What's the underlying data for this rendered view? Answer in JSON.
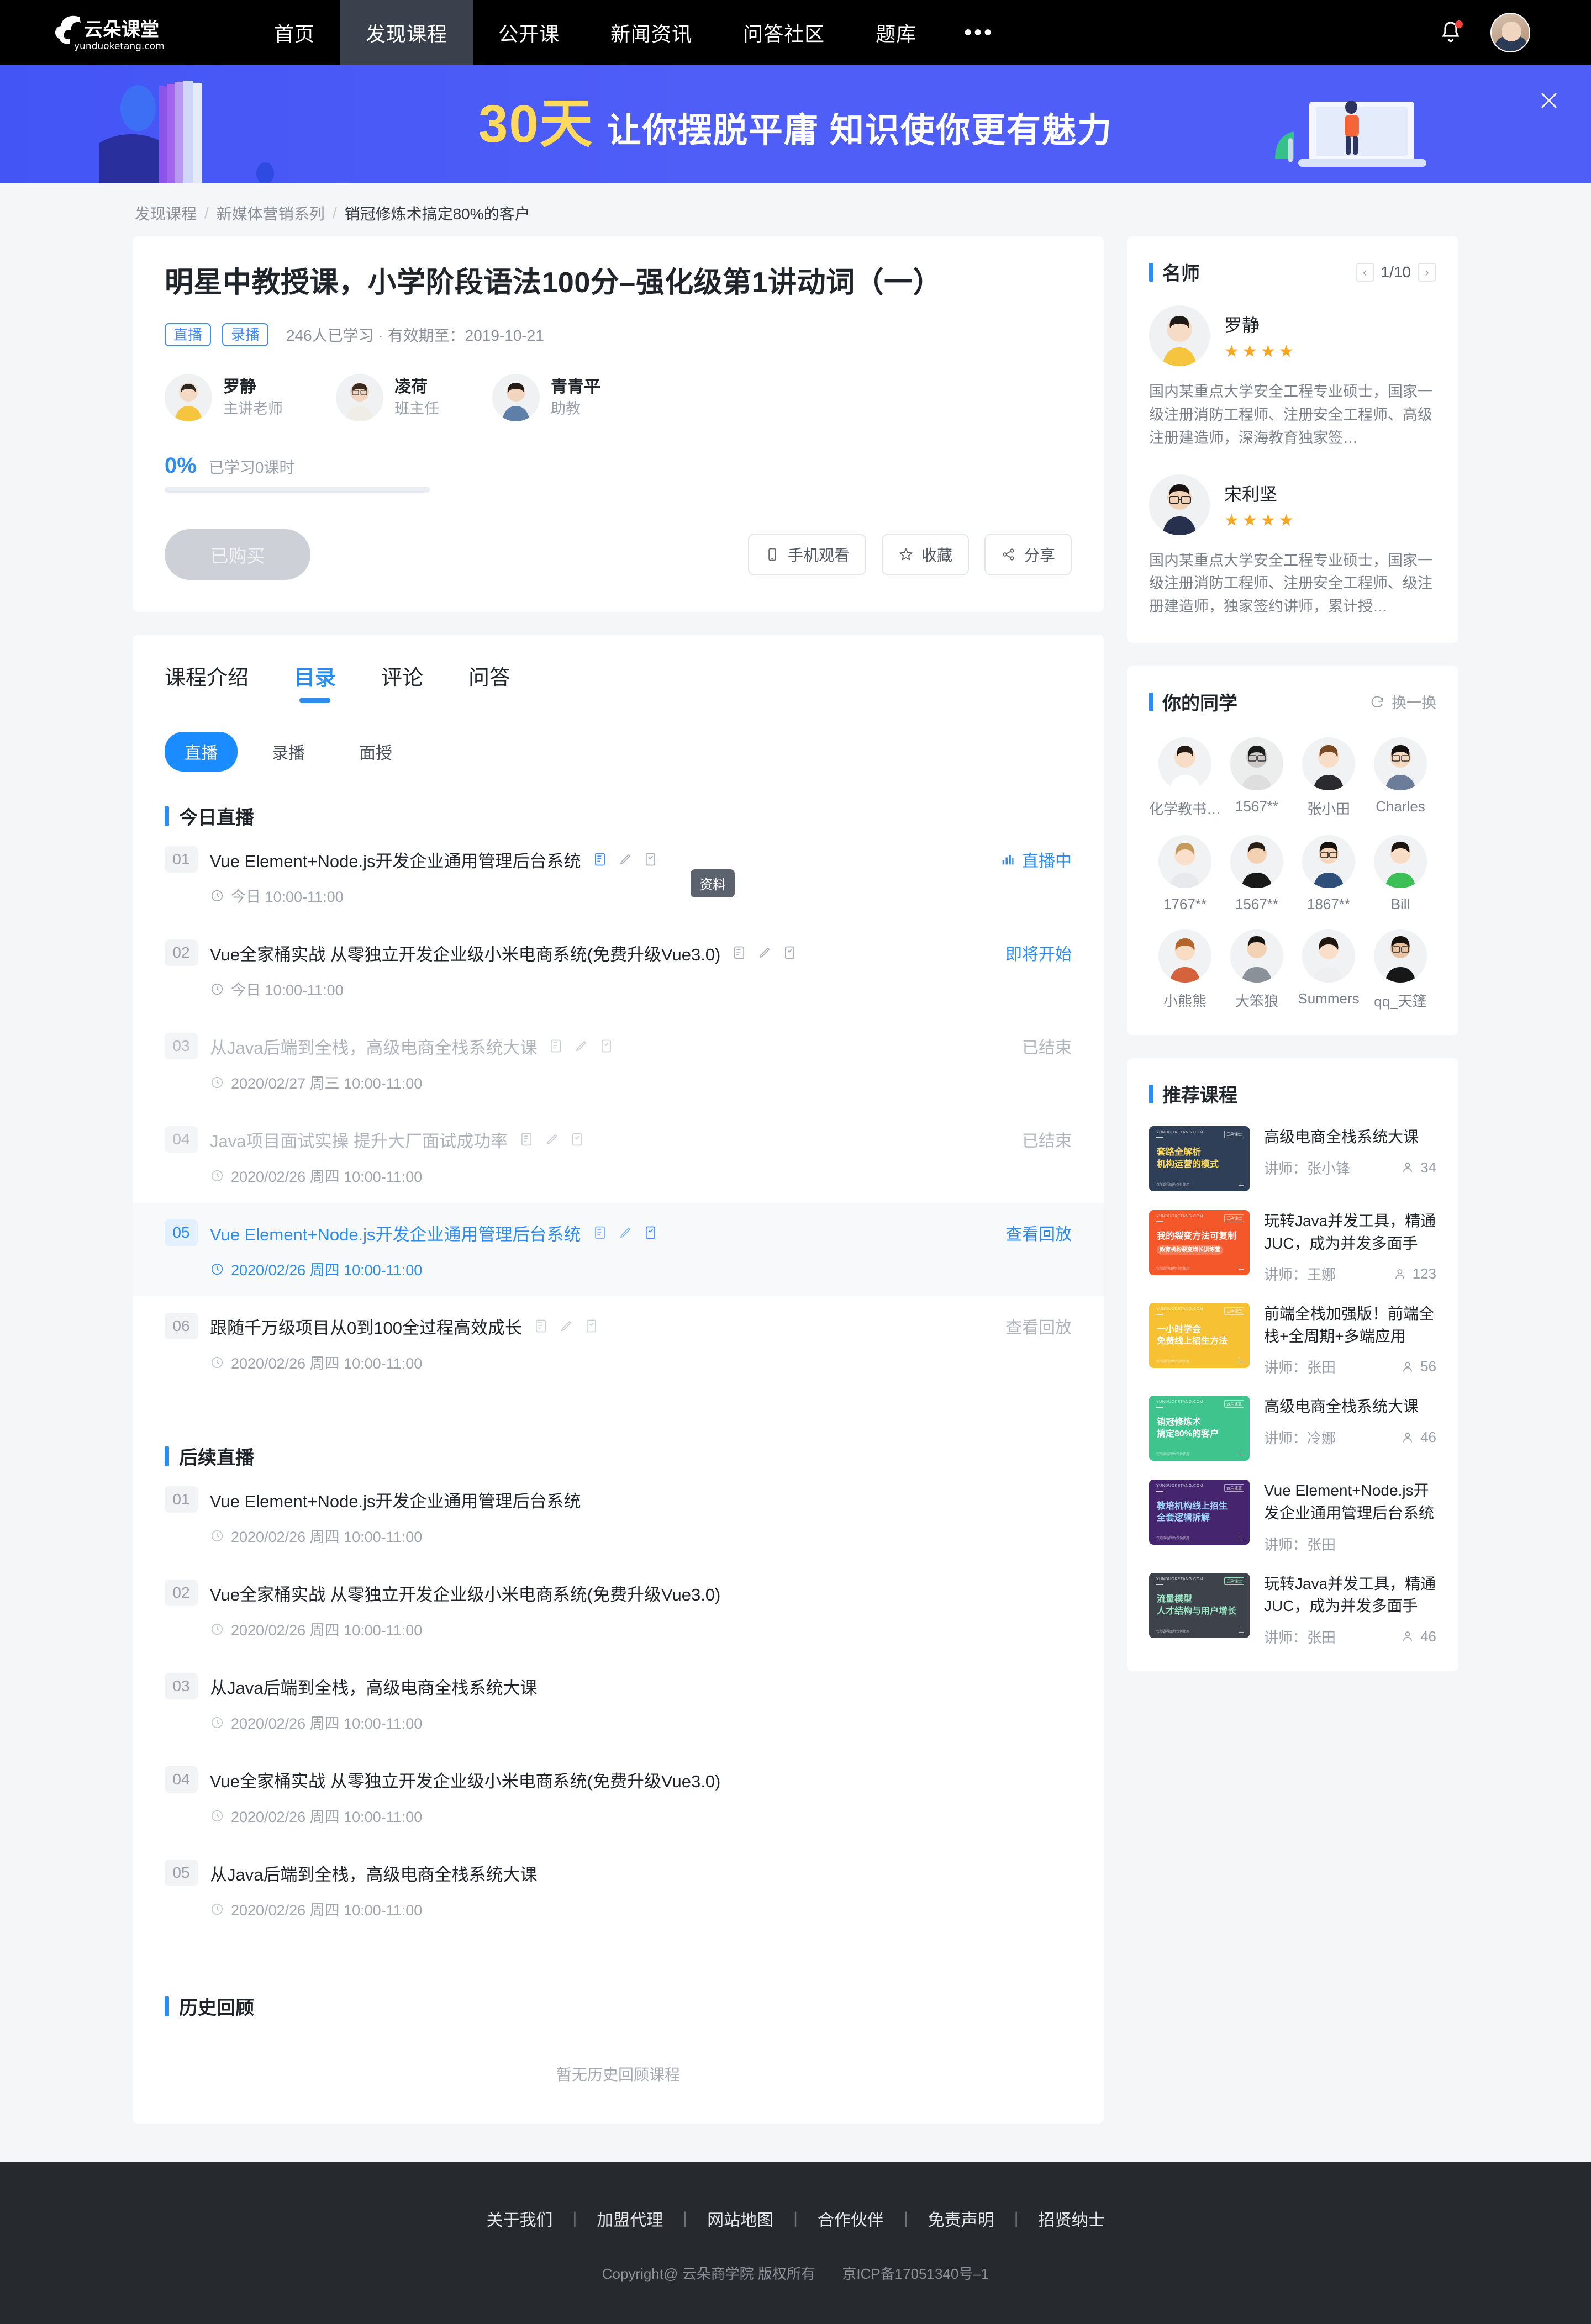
{
  "brand": {
    "name": "云朵课堂",
    "domain": "yunduoketang.com"
  },
  "nav": {
    "items": [
      {
        "label": "首页",
        "active": false
      },
      {
        "label": "发现课程",
        "active": true
      },
      {
        "label": "公开课",
        "active": false
      },
      {
        "label": "新闻资讯",
        "active": false
      },
      {
        "label": "问答社区",
        "active": false
      },
      {
        "label": "题库",
        "active": false
      }
    ],
    "more": "•••",
    "bell_icon": "bell-icon",
    "avatar_icon": "user-avatar"
  },
  "banner": {
    "big": "30天",
    "sub": "让你摆脱平庸  知识使你更有魅力",
    "close_icon": "close-icon"
  },
  "breadcrumb": {
    "items": [
      "发现课程",
      "新媒体营销系列"
    ],
    "current": "销冠修炼术搞定80%的客户",
    "separator": "/"
  },
  "course": {
    "title": "明星中教授课，小学阶段语法100分–强化级第1讲动词（一）",
    "tags": [
      "直播",
      "录播"
    ],
    "meta": "246人已学习 · 有效期至：2019-10-21",
    "teachers": [
      {
        "name": "罗静",
        "role": "主讲老师"
      },
      {
        "name": "凌荷",
        "role": "班主任"
      },
      {
        "name": "青青平",
        "role": "助教"
      }
    ],
    "progress": {
      "percent": "0%",
      "label": "已学习0课时",
      "value": 0
    },
    "buy_label": "已购买",
    "actions": [
      {
        "label": "手机观看",
        "icon": "phone-icon"
      },
      {
        "label": "收藏",
        "icon": "star-icon"
      },
      {
        "label": "分享",
        "icon": "share-icon"
      }
    ]
  },
  "tabs": [
    {
      "label": "课程介绍",
      "active": false
    },
    {
      "label": "目录",
      "active": true
    },
    {
      "label": "评论",
      "active": false
    },
    {
      "label": "问答",
      "active": false
    }
  ],
  "subtabs": [
    {
      "label": "直播",
      "active": true
    },
    {
      "label": "录播",
      "active": false
    },
    {
      "label": "面授",
      "active": false
    }
  ],
  "tooltip": "资料",
  "sections": [
    {
      "title": "今日直播",
      "lessons": [
        {
          "num": "01",
          "title": "Vue Element+Node.js开发企业通用管理后台系统",
          "time": "今日 10:00-11:00",
          "status": "直播中",
          "status_type": "live",
          "icons": true,
          "state": "normal"
        },
        {
          "num": "02",
          "title": "Vue全家桶实战 从零独立开发企业级小米电商系统(免费升级Vue3.0)",
          "time": "今日 10:00-11:00",
          "status": "即将开始",
          "status_type": "soon",
          "icons": true,
          "state": "normal"
        },
        {
          "num": "03",
          "title": "从Java后端到全栈，高级电商全栈系统大课",
          "time": "2020/02/27 周三 10:00-11:00",
          "status": "已结束",
          "status_type": "end",
          "icons": true,
          "state": "done"
        },
        {
          "num": "04",
          "title": "Java项目面试实操 提升大厂面试成功率",
          "time": "2020/02/26 周四 10:00-11:00",
          "status": "已结束",
          "status_type": "end",
          "icons": true,
          "state": "done"
        },
        {
          "num": "05",
          "title": "Vue Element+Node.js开发企业通用管理后台系统",
          "time": "2020/02/26 周四 10:00-11:00",
          "status": "查看回放",
          "status_type": "replay",
          "icons": true,
          "state": "highlight"
        },
        {
          "num": "06",
          "title": "跟随千万级项目从0到100全过程高效成长",
          "time": "2020/02/26 周四 10:00-11:00",
          "status": "查看回放",
          "status_type": "replay-grey",
          "icons": true,
          "state": "normal"
        }
      ]
    },
    {
      "title": "后续直播",
      "lessons": [
        {
          "num": "01",
          "title": "Vue Element+Node.js开发企业通用管理后台系统",
          "time": "2020/02/26 周四 10:00-11:00",
          "status": "",
          "status_type": "none",
          "icons": false,
          "state": "normal"
        },
        {
          "num": "02",
          "title": "Vue全家桶实战 从零独立开发企业级小米电商系统(免费升级Vue3.0)",
          "time": "2020/02/26 周四 10:00-11:00",
          "status": "",
          "status_type": "none",
          "icons": false,
          "state": "normal"
        },
        {
          "num": "03",
          "title": "从Java后端到全栈，高级电商全栈系统大课",
          "time": "2020/02/26 周四 10:00-11:00",
          "status": "",
          "status_type": "none",
          "icons": false,
          "state": "normal"
        },
        {
          "num": "04",
          "title": "Vue全家桶实战 从零独立开发企业级小米电商系统(免费升级Vue3.0)",
          "time": "2020/02/26 周四 10:00-11:00",
          "status": "",
          "status_type": "none",
          "icons": false,
          "state": "normal"
        },
        {
          "num": "05",
          "title": "从Java后端到全栈，高级电商全栈系统大课",
          "time": "2020/02/26 周四 10:00-11:00",
          "status": "",
          "status_type": "none",
          "icons": false,
          "state": "normal"
        }
      ]
    },
    {
      "title": "历史回顾",
      "lessons": [],
      "empty": "暂无历史回顾课程"
    }
  ],
  "sidebar": {
    "famous": {
      "title": "名师",
      "page": "1/10",
      "prev_icon": "chevron-left-icon",
      "next_icon": "chevron-right-icon",
      "teachers": [
        {
          "name": "罗静",
          "stars": 4,
          "desc": "国内某重点大学安全工程专业硕士，国家一级注册消防工程师、注册安全工程师、高级注册建造师，深海教育独家签…"
        },
        {
          "name": "宋利坚",
          "stars": 4,
          "desc": "国内某重点大学安全工程专业硕士，国家一级注册消防工程师、注册安全工程师、级注册建造师，独家签约讲师，累计授…"
        }
      ]
    },
    "classmates": {
      "title": "你的同学",
      "refresh_label": "换一换",
      "refresh_icon": "refresh-icon",
      "people": [
        {
          "name": "化学教书…"
        },
        {
          "name": "1567**"
        },
        {
          "name": "张小田"
        },
        {
          "name": "Charles"
        },
        {
          "name": "1767**"
        },
        {
          "name": "1567**"
        },
        {
          "name": "1867**"
        },
        {
          "name": "Bill"
        },
        {
          "name": "小熊熊"
        },
        {
          "name": "大笨狼"
        },
        {
          "name": "Summers"
        },
        {
          "name": "qq_天篷"
        }
      ]
    },
    "recommend": {
      "title": "推荐课程",
      "teacher_prefix": "讲师：",
      "courses": [
        {
          "title": "高级电商全栈系统大课",
          "teacher": "张小锋",
          "count": "34",
          "thumb_color": "#2f3f57",
          "thumb_line1": "套路全解析",
          "thumb_line2": "机构运营的模式",
          "thumb_brand": "YUNDUOKETANG.COM",
          "thumb_badge": "云朵课堂",
          "thumb_foot": "仅限课程图片仅供使用"
        },
        {
          "title": "玩转Java并发工具，精通JUC，成为并发多面手",
          "teacher": "王娜",
          "count": "123",
          "thumb_color": "#f4582a",
          "thumb_line1": "我的裂变方法可复制",
          "thumb_line2": "教育机构裂变增长训练营",
          "thumb_brand": "YUNDUOKETANG.COM",
          "thumb_badge": "云朵课堂",
          "thumb_foot": "仅限课程图片仅供使用"
        },
        {
          "title": "前端全栈加强版！前端全栈+全周期+多端应用",
          "teacher": "张田",
          "count": "56",
          "thumb_color": "#f6c234",
          "thumb_line1": "一小时学会",
          "thumb_line2": "免费线上招生方法",
          "thumb_brand": "YUNDUOKETANG.COM",
          "thumb_badge": "云朵课堂",
          "thumb_foot": "仅限课程图片仅供使用"
        },
        {
          "title": "高级电商全栈系统大课",
          "teacher": "冷娜",
          "count": "46",
          "thumb_color": "#3ec48c",
          "thumb_line1": "销冠修炼术",
          "thumb_line2": "搞定80%的客户",
          "thumb_brand": "YUNDUOKETANG.COM",
          "thumb_badge": "云朵课堂",
          "thumb_foot": "仅限课程图片仅供使用"
        },
        {
          "title": "Vue Element+Node.js开发企业通用管理后台系统",
          "teacher": "张田",
          "count": "",
          "thumb_color": "#45266e",
          "thumb_line1": "教培机构线上招生",
          "thumb_line2": "全套逻辑拆解",
          "thumb_brand": "YUNDUOKETANG.COM",
          "thumb_badge": "云朵课堂",
          "thumb_foot": "仅限课程图片仅供使用"
        },
        {
          "title": "玩转Java并发工具，精通JUC，成为并发多面手",
          "teacher": "张田",
          "count": "46",
          "thumb_color": "#3d424b",
          "thumb_line1": "流量模型",
          "thumb_line2": "人才结构与用户增长",
          "thumb_brand": "YUNDUOKETANG.COM",
          "thumb_badge": "云朵课堂",
          "thumb_foot": "仅限课程图片仅供使用"
        }
      ]
    }
  },
  "footer": {
    "links": [
      "关于我们",
      "加盟代理",
      "网站地图",
      "合作伙伴",
      "免责声明",
      "招贤纳士"
    ],
    "separator": "|",
    "copyright": "Copyright@ 云朵商学院   版权所有",
    "icp": "京ICP备17051340号–1"
  },
  "colors": {
    "accent": "#2d8cf0",
    "banner_blue": "#4f5ef7",
    "banner_yellow": "#ffd95c",
    "star": "#f5a623",
    "dark": "#26292e"
  }
}
